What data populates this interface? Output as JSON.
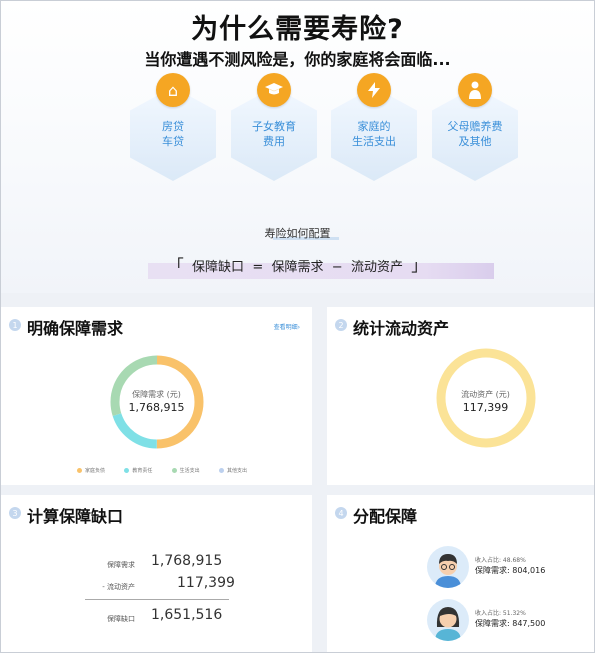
{
  "header": {
    "title": "为什么需要寿险?",
    "subtitle": "当你遭遇不测风险是，你的家庭将会面临..."
  },
  "risks": [
    {
      "icon": "house-icon",
      "line1": "房贷",
      "line2": "车贷",
      "glyph": "⌂"
    },
    {
      "icon": "graduation-cap-icon",
      "line1": "子女教育",
      "line2": "费用",
      "glyph": "🎓"
    },
    {
      "icon": "lightning-icon",
      "line1": "家庭的",
      "line2": "生活支出",
      "glyph": "⚡"
    },
    {
      "icon": "elder-person-icon",
      "line1": "父母赡养费",
      "line2": "及其他",
      "glyph": "👴"
    }
  ],
  "config": {
    "title": "寿险如何配置",
    "formula": {
      "open": "「",
      "left": "保障缺口",
      "eq": "=",
      "a": "保障需求",
      "minus": "−",
      "b": "流动资产",
      "close": "」"
    }
  },
  "cards": {
    "demand": {
      "num": "1",
      "title": "明确保障需求",
      "link": "查看明细›",
      "ring_label": "保障需求 (元)",
      "ring_value": "1,768,915",
      "legend": [
        {
          "label": "家庭负债",
          "color": "#f9c26a"
        },
        {
          "label": "教育责任",
          "color": "#7fe0e6"
        },
        {
          "label": "生活支出",
          "color": "#a8d9b2"
        },
        {
          "label": "其他支出",
          "color": "#bcd0ee"
        }
      ]
    },
    "assets": {
      "num": "2",
      "title": "统计流动资产",
      "ring_label": "流动资产 (元)",
      "ring_value": "117,399"
    },
    "gap": {
      "num": "3",
      "title": "计算保障缺口",
      "rows": [
        {
          "label": "保障需求",
          "value": "1,768,915"
        },
        {
          "label": "- 流动资产",
          "value": "117,399"
        },
        {
          "label": "保障缺口",
          "value": "1,651,516"
        }
      ]
    },
    "allocate": {
      "num": "4",
      "title": "分配保障",
      "people": [
        {
          "ratio": "收入占比: 48.68%",
          "need": "保障需求: 804,016"
        },
        {
          "ratio": "收入占比: 51.32%",
          "need": "保障需求: 847,500"
        }
      ]
    }
  },
  "chart_data": {
    "type": "pie",
    "title": "保障需求 (元)",
    "total": "1,768,915",
    "categories": [
      "家庭负债",
      "教育责任",
      "生活支出",
      "其他支出"
    ],
    "values": [
      0.5,
      0.2,
      0.3,
      0.0
    ]
  },
  "colors": {
    "accent": "#f5a623",
    "link": "#3a8fd9",
    "ring_assets": "#fbe397"
  }
}
